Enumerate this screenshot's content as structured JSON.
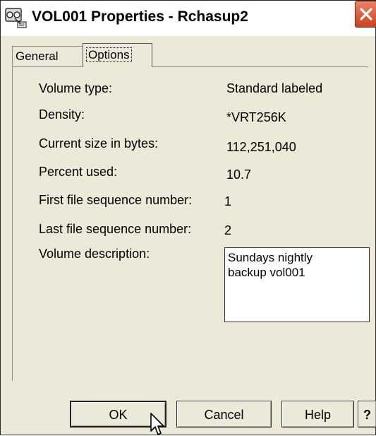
{
  "window": {
    "title": "VOL001 Properties - Rchasup2"
  },
  "tabs": [
    {
      "label": "General",
      "selected": false
    },
    {
      "label": "Options",
      "selected": true
    }
  ],
  "fields": {
    "volume_type": {
      "label": "Volume type:",
      "value": "Standard labeled"
    },
    "density": {
      "label": "Density:",
      "value": "*VRT256K"
    },
    "current_size": {
      "label": "Current size in bytes:",
      "value": "112,251,040"
    },
    "percent_used": {
      "label": "Percent used:",
      "value": "10.7"
    },
    "first_file_seq": {
      "label": "First file sequence number:",
      "value": "1"
    },
    "last_file_seq": {
      "label": "Last file sequence number:",
      "value": "2"
    },
    "volume_description": {
      "label": "Volume description:",
      "value": "Sundays nightly\nbackup vol001"
    }
  },
  "buttons": {
    "ok": "OK",
    "cancel": "Cancel",
    "help": "Help",
    "question": "?"
  },
  "colors": {
    "dialog_background": "#ece9d8",
    "close_button": "#c9421e"
  },
  "icons": {
    "title": "volume-icon",
    "close": "close-icon",
    "cursor": "mouse-pointer-icon"
  }
}
